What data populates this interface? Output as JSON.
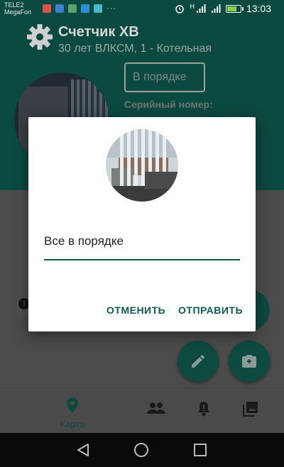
{
  "status_bar": {
    "carrier_line1": "TELE2",
    "carrier_line2": "MegaFon",
    "more": "···",
    "time": "13:03",
    "network_h": "H"
  },
  "app_bar": {
    "title": "Счетчик ХВ",
    "subtitle": "30 лет ВЛКСМ, 1 - Котельная"
  },
  "background": {
    "status_field": "В порядке",
    "serial_label": "Серийный номер:",
    "info_glyph": "i"
  },
  "dialog": {
    "input_value": "Все в порядке",
    "cancel_label": "ОТМЕНИТЬ",
    "send_label": "ОТПРАВИТЬ"
  },
  "bottom_nav": {
    "items": [
      {
        "label": "Карта",
        "icon": "location-pin-icon",
        "active": true
      },
      {
        "icon": "people-icon"
      },
      {
        "icon": "alert-bell-icon"
      },
      {
        "icon": "gallery-icon"
      }
    ]
  },
  "colors": {
    "primary": "#0d5a4e",
    "app_bar": "#0b4a40",
    "dialog_bg": "#ffffff"
  }
}
